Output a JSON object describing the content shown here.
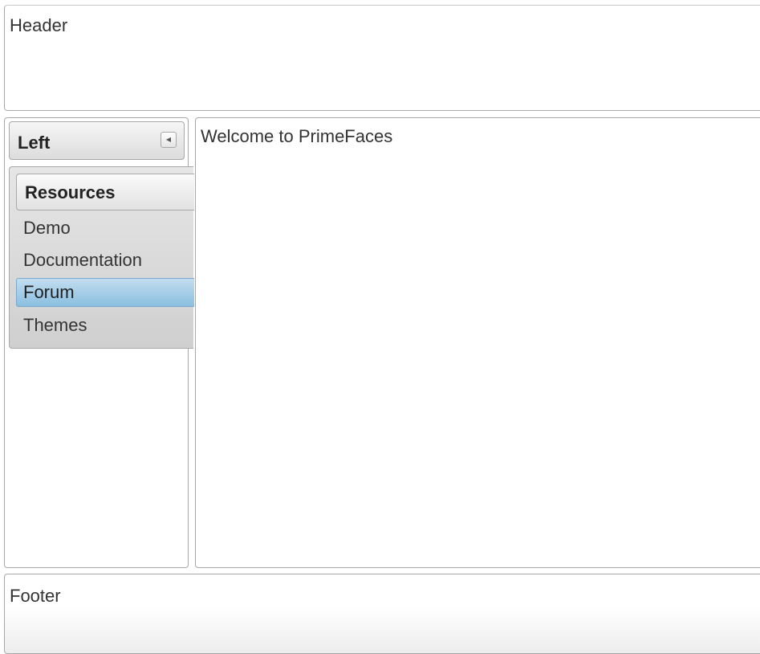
{
  "header": {
    "text": "Header"
  },
  "left": {
    "title": "Left",
    "collapse_icon": "triangle-left-icon",
    "menu": {
      "heading": "Resources",
      "items": [
        {
          "label": "Demo",
          "active": false
        },
        {
          "label": "Documentation",
          "active": false
        },
        {
          "label": "Forum",
          "active": true
        },
        {
          "label": "Themes",
          "active": false
        }
      ]
    }
  },
  "center": {
    "text": "Welcome to PrimeFaces"
  },
  "footer": {
    "text": "Footer"
  },
  "colors": {
    "active_item": "#a9cfe9",
    "border": "#a8a8a8"
  }
}
